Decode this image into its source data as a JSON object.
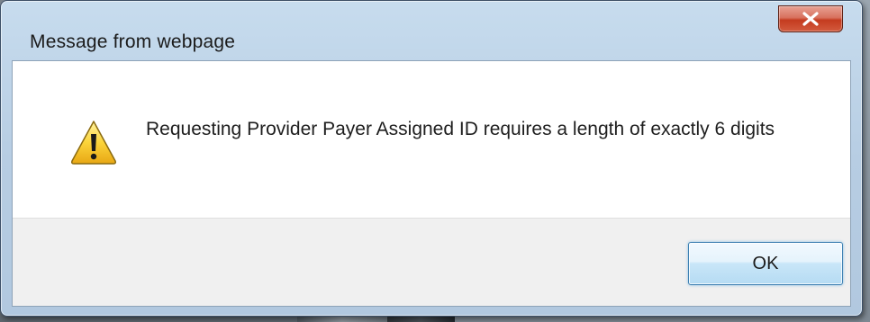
{
  "dialog": {
    "title": "Message from webpage",
    "message": "Requesting Provider Payer Assigned ID requires a length of exactly 6 digits",
    "icon": "warning-icon",
    "ok_label": "OK",
    "close_icon": "close-icon"
  },
  "colors": {
    "close_button": "#c94a2f",
    "ok_border": "#3c7fb1",
    "footer_bg": "#f0f0f0",
    "title_bar": "#b9cfe4"
  }
}
